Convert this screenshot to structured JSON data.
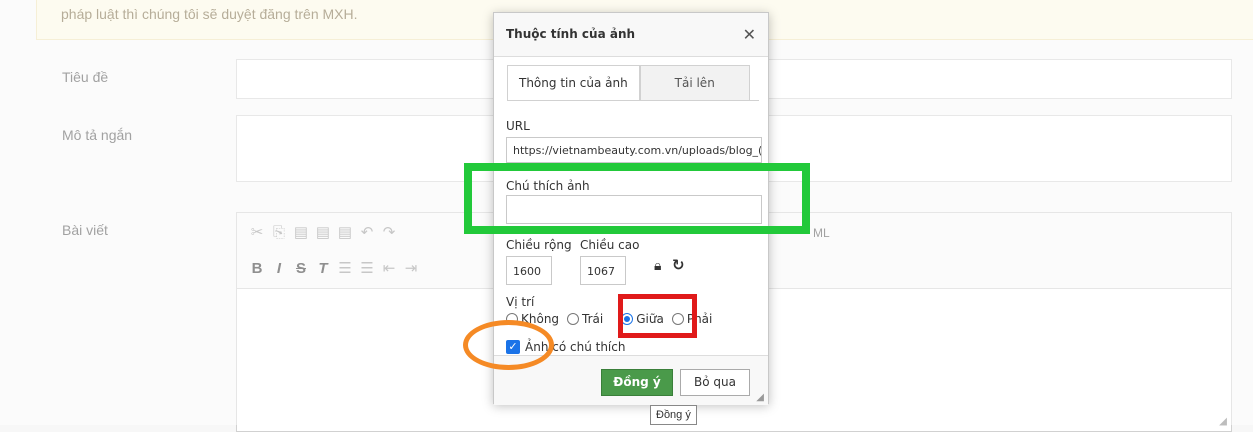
{
  "page": {
    "notice_text": "pháp luật thì chúng tôi sẽ duyệt đăng trên MXH.",
    "labels": {
      "title": "Tiêu đề",
      "short_description": "Mô tả ngắn",
      "article": "Bài viết"
    },
    "editor": {
      "source_label": "ML"
    }
  },
  "dialog": {
    "title": "Thuộc tính của ảnh",
    "tabs": [
      {
        "label": "Thông tin của ảnh",
        "active": true
      },
      {
        "label": "Tải lên",
        "active": false
      }
    ],
    "url_label": "URL",
    "url_value": "https://vietnambeauty.com.vn/uploads/blog_(",
    "caption_label": "Chú thích ảnh",
    "caption_value": "",
    "width_label": "Chiều rộng",
    "width_value": "1600",
    "height_label": "Chiều cao",
    "height_value": "1067",
    "position_label": "Vị trí",
    "position_options": [
      "Không",
      "Trái",
      "Giữa",
      "Phải"
    ],
    "position_selected": "Giữa",
    "caption_checkbox_label": "Ảnh có chú thích",
    "caption_checkbox_checked": true,
    "ok_label": "Đồng ý",
    "cancel_label": "Bỏ qua"
  },
  "tooltip": "Đồng ý",
  "colors": {
    "ok_button": "#4a9a4a",
    "annotation_green": "#22c93a",
    "annotation_red": "#e01a1a",
    "annotation_orange": "#f58a25",
    "selected_radio": "#1a73e8"
  }
}
